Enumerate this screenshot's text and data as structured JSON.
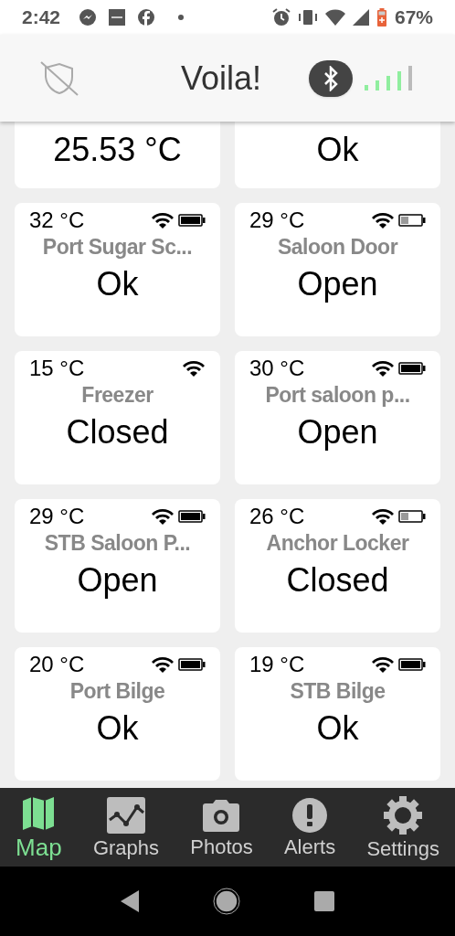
{
  "status_bar": {
    "time": "2:42",
    "battery": "67%"
  },
  "header": {
    "title": "Voila!"
  },
  "top_row": [
    {
      "value": "25.53 °C"
    },
    {
      "value": "Ok"
    }
  ],
  "sensors": [
    {
      "temperature": "32 °C",
      "name": "Port Sugar Sc...",
      "state": "Ok",
      "battery_shown": true,
      "battery_low": false
    },
    {
      "temperature": "29 °C",
      "name": "Saloon Door",
      "state": "Open",
      "battery_shown": true,
      "battery_low": true
    },
    {
      "temperature": "15 °C",
      "name": "Freezer",
      "state": "Closed",
      "battery_shown": false
    },
    {
      "temperature": "30 °C",
      "name": "Port saloon p...",
      "state": "Open",
      "battery_shown": true,
      "battery_low": false
    },
    {
      "temperature": "29 °C",
      "name": "STB Saloon P...",
      "state": "Open",
      "battery_shown": true,
      "battery_low": false
    },
    {
      "temperature": "26 °C",
      "name": "Anchor Locker",
      "state": "Closed",
      "battery_shown": true,
      "battery_low": true
    },
    {
      "temperature": "20 °C",
      "name": "Port Bilge",
      "state": "Ok",
      "battery_shown": true,
      "battery_low": false
    },
    {
      "temperature": "19 °C",
      "name": "STB Bilge",
      "state": "Ok",
      "battery_shown": true,
      "battery_low": false
    }
  ],
  "nav": [
    {
      "label": "Map",
      "kind": "map",
      "selected": true
    },
    {
      "label": "Graphs",
      "kind": "graphs",
      "selected": false
    },
    {
      "label": "Photos",
      "kind": "photos",
      "selected": false
    },
    {
      "label": "Alerts",
      "kind": "alerts",
      "selected": false
    },
    {
      "label": "Settings",
      "kind": "settings",
      "selected": false
    }
  ]
}
